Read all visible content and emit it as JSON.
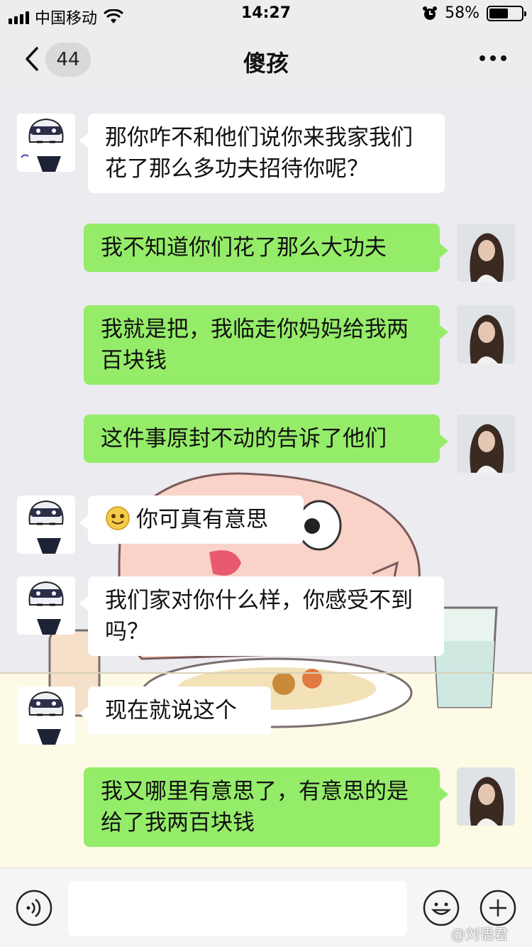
{
  "status_bar": {
    "carrier": "中国移动",
    "time": "14:27",
    "battery": "58%",
    "battery_level": 0.58
  },
  "nav": {
    "unread_count": "44",
    "title": "傻孩"
  },
  "messages": [
    {
      "side": "in",
      "text": "那你咋不和他们说你来我家我们花了那么多功夫招待你呢？"
    },
    {
      "side": "out",
      "text": "我不知道你们花了那么大功夫"
    },
    {
      "side": "out",
      "text": "我就是把，我临走你妈妈给我两百块钱"
    },
    {
      "side": "out",
      "text": "这件事原封不动的告诉了他们"
    },
    {
      "side": "in",
      "emoji": "smile-emoji",
      "text": "你可真有意思"
    },
    {
      "side": "in",
      "text": "我们家对你什么样，你感受不到吗？"
    },
    {
      "side": "in",
      "text": "现在就说这个"
    },
    {
      "side": "out",
      "text": "我又哪里有意思了，有意思的是给了我两百块钱"
    }
  ],
  "input": {
    "value": "",
    "placeholder": ""
  },
  "watermark": "@刘语君",
  "colors": {
    "outgoing_bubble": "#95ec69",
    "incoming_bubble": "#ffffff",
    "background": "#ededed"
  },
  "icons": [
    "back-icon",
    "more-icon",
    "voice-icon",
    "emoji-icon",
    "plus-icon",
    "wifi-icon",
    "alarm-icon",
    "battery-icon",
    "signal-icon"
  ]
}
